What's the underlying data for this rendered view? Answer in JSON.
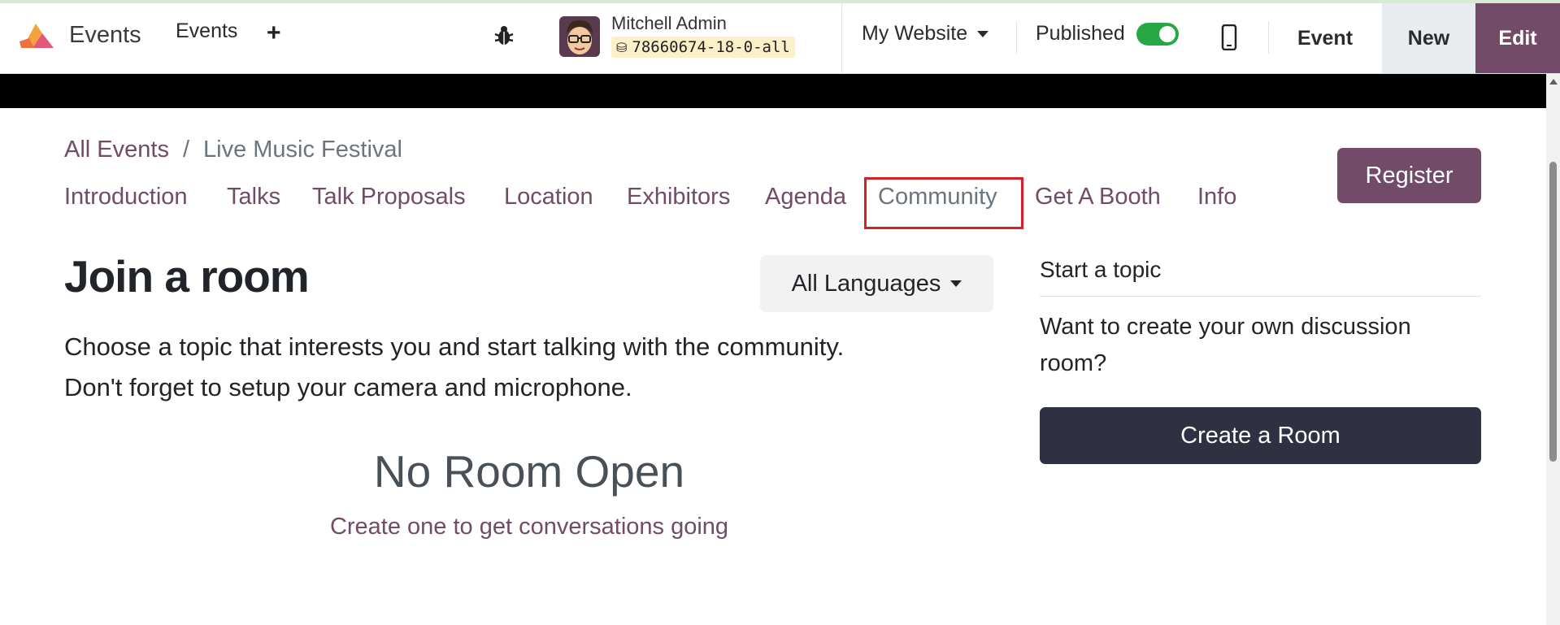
{
  "navbar": {
    "app_name": "Events",
    "menu_events": "Events",
    "new_icon": "+",
    "user_name": "Mitchell Admin",
    "database": "78660674-18-0-all",
    "website": "My Website",
    "published_label": "Published",
    "published": true,
    "event_button": "Event",
    "new_button": "New",
    "edit_button": "Edit"
  },
  "breadcrumb": {
    "parent": "All Events",
    "separator": "/",
    "current": "Live Music Festival"
  },
  "register_button": "Register",
  "event_tabs": [
    {
      "label": "Introduction"
    },
    {
      "label": "Talks"
    },
    {
      "label": "Talk Proposals"
    },
    {
      "label": "Location"
    },
    {
      "label": "Exhibitors"
    },
    {
      "label": "Agenda"
    },
    {
      "label": "Community"
    },
    {
      "label": "Get A Booth"
    },
    {
      "label": "Info"
    }
  ],
  "main": {
    "title": "Join a room",
    "language_filter": "All Languages",
    "intro_line1": "Choose a topic that interests you and start talking with the community.",
    "intro_line2": "Don't forget to setup your camera and microphone.",
    "empty_title": "No Room Open",
    "empty_subtitle": "Create one to get conversations going"
  },
  "sidebar": {
    "title": "Start a topic",
    "text": "Want to create your own discussion room?",
    "create_button": "Create a Room"
  },
  "colors": {
    "brand": "#714b67",
    "dark_button": "#2f3142",
    "toggle_on": "#28a745",
    "highlight": "#d42026"
  },
  "icons": {
    "logo": "odoo-events-logo",
    "debug": "bug-icon",
    "mobile": "mobile-phone-icon",
    "database": "database-icon"
  }
}
